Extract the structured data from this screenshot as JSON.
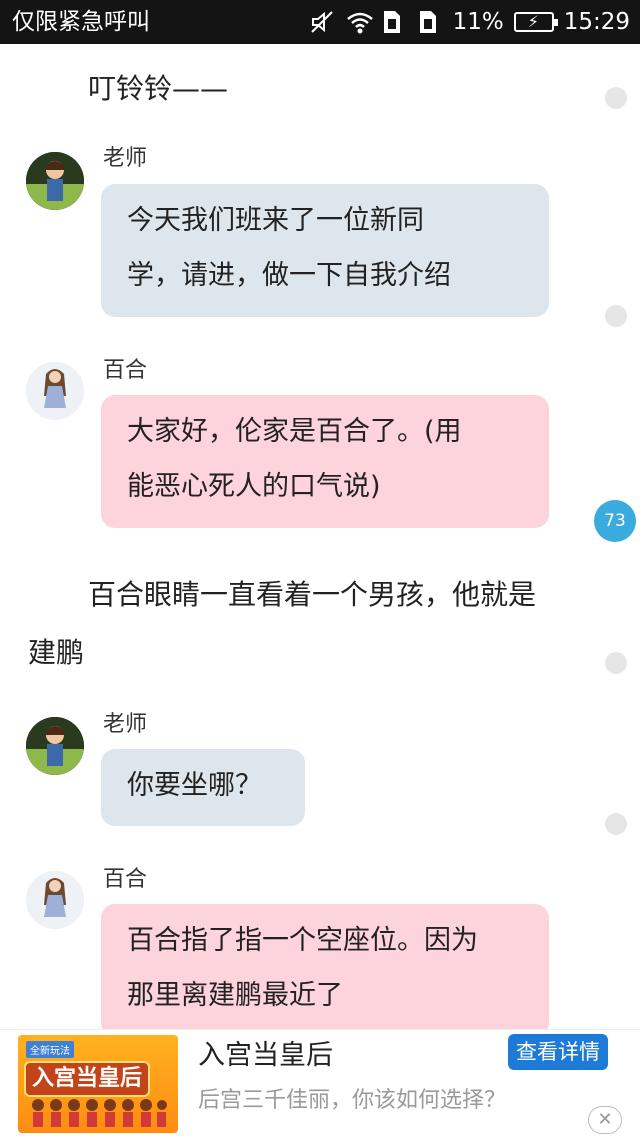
{
  "status_bar": {
    "left_text": "仅限紧急呼叫",
    "battery": "11%",
    "time": "15:29",
    "icons": [
      "mute-icon",
      "wifi-icon",
      "sim1-icon",
      "sim2-icon",
      "battery-icon"
    ]
  },
  "story": {
    "narration_1": "叮铃铃——",
    "msg1": {
      "name": "老师",
      "line1": "今天我们班来了一位新同",
      "line2": "学，请进，做一下自我介绍"
    },
    "msg2": {
      "name": "百合",
      "line1": "大家好，伦家是百合了。(用",
      "line2": "能恶心死人的口气说)"
    },
    "narration_2_line1": "百合眼睛一直看着一个男孩，他就是",
    "narration_2_line2": "建鹏",
    "msg3": {
      "name": "老师",
      "line1": "你要坐哪？"
    },
    "msg4": {
      "name": "百合",
      "line1": "百合指了指一个空座位。因为",
      "line2": "那里离建鹏最近了"
    },
    "comment_count": "73"
  },
  "ad": {
    "title": "入宫当皇后",
    "description": "后宫三千佳丽，你该如何选择？",
    "button": "查看详情",
    "close": "✕",
    "image_tag": "全新玩法",
    "image_logo": "入宫当皇后"
  },
  "colors": {
    "teacher_bubble": "#dde6ec",
    "lily_bubble": "#fdd3dc",
    "badge": "#3aabdc",
    "ad_button": "#1d7ad7"
  }
}
